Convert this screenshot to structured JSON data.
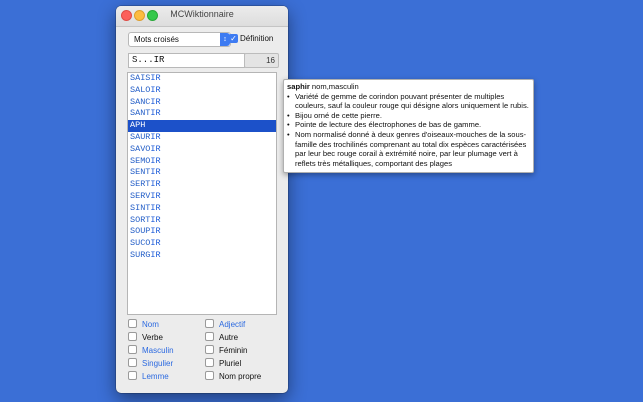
{
  "window": {
    "title": "MCWiktionnaire"
  },
  "toolbar": {
    "mode_value": "Mots croisés",
    "definition_checked": true,
    "definition_label": "Définition"
  },
  "search": {
    "value": "S...IR",
    "count": "16"
  },
  "results": [
    {
      "prefix": "SAIS",
      "suffix": "IR"
    },
    {
      "prefix": "SALO",
      "suffix": "IR"
    },
    {
      "prefix": "SANC",
      "suffix": "IR"
    },
    {
      "prefix": "SANT",
      "suffix": "IR"
    },
    {
      "prefix": " APH",
      "suffix": "  ",
      "selected": true
    },
    {
      "prefix": "SAUR",
      "suffix": "IR"
    },
    {
      "prefix": "SAVO",
      "suffix": "IR"
    },
    {
      "prefix": "SEMO",
      "suffix": "IR"
    },
    {
      "prefix": "SENT",
      "suffix": "IR"
    },
    {
      "prefix": "SERT",
      "suffix": "IR"
    },
    {
      "prefix": "SERV",
      "suffix": "IR"
    },
    {
      "prefix": "SINT",
      "suffix": "IR"
    },
    {
      "prefix": "SORT",
      "suffix": "IR"
    },
    {
      "prefix": "SOUP",
      "suffix": "IR"
    },
    {
      "prefix": "SUCO",
      "suffix": "IR"
    },
    {
      "prefix": "SURG",
      "suffix": "IR"
    }
  ],
  "filters": [
    {
      "label": "Nom",
      "style": "blue"
    },
    {
      "label": "Adjectif",
      "style": "blue"
    },
    {
      "label": "Verbe",
      "style": "dark"
    },
    {
      "label": "Autre",
      "style": "dark"
    },
    {
      "label": "Masculin",
      "style": "blue"
    },
    {
      "label": "Féminin",
      "style": "dark"
    },
    {
      "label": "Singulier",
      "style": "blue"
    },
    {
      "label": "Pluriel",
      "style": "dark"
    },
    {
      "label": "Lemme",
      "style": "blue"
    },
    {
      "label": "Nom propre",
      "style": "dark"
    }
  ],
  "tooltip": {
    "word": "saphir",
    "info": "nom,masculin",
    "definitions": [
      "Variété de gemme de corindon pouvant présenter de multiples couleurs, sauf la couleur rouge qui désigne alors uniquement le rubis.",
      "Bijou orné de cette pierre.",
      "Pointe de lecture des électrophones de bas de gamme.",
      "Nom normalisé donné à deux genres d'oiseaux-mouches de la sous-famille des trochilinés comprenant au total dix espèces caractérisées par leur bec rouge corail à extrémité noire, par leur plumage vert à reflets très métalliques, comportant des plages"
    ]
  },
  "colors": {
    "desktop": "#3b6fd6",
    "accent": "#3d7bf2",
    "selection": "#1c51c9",
    "result_text": "#2660c8"
  }
}
